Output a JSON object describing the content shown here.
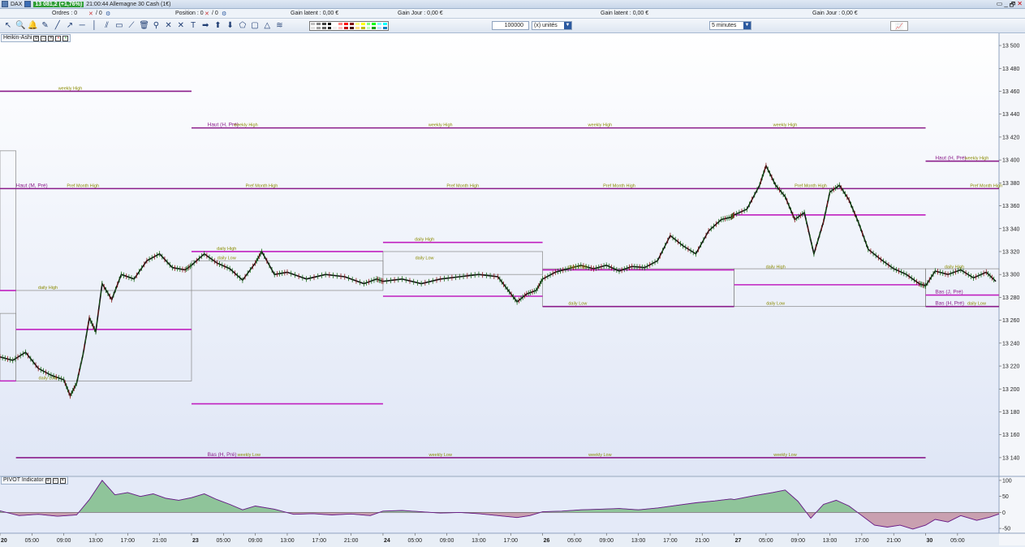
{
  "titlebar": {
    "instrument": "DAX",
    "price_badge": "13 081,2 (+1,76%)",
    "info": "21:00:44 Allemagne 30 Cash (1€)",
    "win_buttons": [
      "▭",
      "_",
      "🗗",
      "✕"
    ]
  },
  "status": {
    "orders_label": "Ordres : 0",
    "orders_count": "/ 0",
    "position_label": "Position : 0",
    "position_count": "/ 0",
    "gain_latent_1": "Gain latent : 0,00 €",
    "gain_jour_1": "Gain Jour : 0,00 €",
    "gain_latent_2": "Gain latent : 0,00 €",
    "gain_jour_2": "Gain Jour : 0,00 €"
  },
  "toolbar": {
    "quantity": "100000",
    "unit": "(x) unités",
    "timeframe": "5 minutes",
    "tools": [
      "pointer-tool",
      "zoom-tool",
      "bell-tool",
      "pencil-tool",
      "line-tool",
      "ray-tool",
      "hline-tool",
      "vline-tool",
      "channel-tool",
      "rect-tool",
      "trend-tool",
      "trash-tool",
      "magnet-tool",
      "xcross-tool",
      "xline-tool",
      "text-tool",
      "arrow-right-tool",
      "arrow-up-tool",
      "arrow-down-tool",
      "shape-tool",
      "box-tool",
      "triangle-tool",
      "fib-tool"
    ],
    "palette": [
      "#c0c0c0",
      "#808080",
      "#404040",
      "#000000",
      "#ffffff",
      "#ff8080",
      "#ff0000",
      "#800000",
      "#ffff80",
      "#ffff00",
      "#80ff80",
      "#00ff00",
      "#80ffff",
      "#00ffff",
      "#e0e0e0",
      "#a0a0a0",
      "#606060",
      "#202020",
      "#f0f0f0",
      "#ffc0c0",
      "#c00000",
      "#400000",
      "#ffe080",
      "#c0c000",
      "#c0ffc0",
      "#00a000",
      "#c0e0ff",
      "#0080c0"
    ]
  },
  "panels": {
    "main_label": "Heikin-Ashi",
    "indicator_label": "PIVOT Indicator"
  },
  "chart_data": {
    "type": "line",
    "title": "",
    "price_axis": {
      "ylim": [
        13130,
        13505
      ],
      "ticks": [
        13500,
        13480,
        13460,
        13440,
        13420,
        13400,
        13380,
        13360,
        13340,
        13320,
        13300,
        13280,
        13260,
        13240,
        13220,
        13200,
        13180,
        13160,
        13140
      ]
    },
    "indicator_axis": {
      "ylim": [
        -65,
        110
      ],
      "ticks": [
        100,
        50,
        0,
        -50
      ],
      "labels": [
        "100",
        "50",
        "0",
        "-50"
      ]
    },
    "time_axis": {
      "labels": [
        {
          "t": 0,
          "text": "20",
          "bold": true
        },
        {
          "t": 1,
          "text": "05:00"
        },
        {
          "t": 2,
          "text": "09:00"
        },
        {
          "t": 3,
          "text": "13:00"
        },
        {
          "t": 4,
          "text": "17:00"
        },
        {
          "t": 5,
          "text": "21:00"
        },
        {
          "t": 6,
          "text": "23",
          "bold": true
        },
        {
          "t": 7,
          "text": "05:00"
        },
        {
          "t": 8,
          "text": "09:00"
        },
        {
          "t": 9,
          "text": "13:00"
        },
        {
          "t": 10,
          "text": "17:00"
        },
        {
          "t": 11,
          "text": "21:00"
        },
        {
          "t": 12,
          "text": "24",
          "bold": true
        },
        {
          "t": 13,
          "text": "05:00"
        },
        {
          "t": 14,
          "text": "09:00"
        },
        {
          "t": 15,
          "text": "13:00"
        },
        {
          "t": 16,
          "text": "17:00"
        },
        {
          "t": 17,
          "text": "26",
          "bold": true
        },
        {
          "t": 18,
          "text": "05:00"
        },
        {
          "t": 19,
          "text": "09:00"
        },
        {
          "t": 20,
          "text": "13:00"
        },
        {
          "t": 21,
          "text": "17:00"
        },
        {
          "t": 22,
          "text": "21:00"
        },
        {
          "t": 23,
          "text": "27",
          "bold": true
        },
        {
          "t": 24,
          "text": "05:00"
        },
        {
          "t": 25,
          "text": "09:00"
        },
        {
          "t": 26,
          "text": "13:00"
        },
        {
          "t": 27,
          "text": "17:00"
        },
        {
          "t": 28,
          "text": "21:00"
        },
        {
          "t": 29,
          "text": "30",
          "bold": true
        },
        {
          "t": 30,
          "text": "05:00"
        }
      ],
      "tmax": 31.3
    },
    "price_series": {
      "name": "",
      "points": [
        [
          0,
          13228
        ],
        [
          0.4,
          13225
        ],
        [
          0.8,
          13232
        ],
        [
          1.2,
          13218
        ],
        [
          1.6,
          13212
        ],
        [
          2.0,
          13208
        ],
        [
          2.2,
          13194
        ],
        [
          2.4,
          13205
        ],
        [
          2.6,
          13230
        ],
        [
          2.8,
          13262
        ],
        [
          3.0,
          13250
        ],
        [
          3.2,
          13292
        ],
        [
          3.5,
          13278
        ],
        [
          3.8,
          13300
        ],
        [
          4.2,
          13296
        ],
        [
          4.6,
          13312
        ],
        [
          5.0,
          13318
        ],
        [
          5.4,
          13306
        ],
        [
          5.8,
          13304
        ],
        [
          6.0,
          13308
        ],
        [
          6.4,
          13318
        ],
        [
          6.8,
          13310
        ],
        [
          7.2,
          13305
        ],
        [
          7.6,
          13295
        ],
        [
          8.0,
          13310
        ],
        [
          8.2,
          13320
        ],
        [
          8.6,
          13300
        ],
        [
          9.0,
          13302
        ],
        [
          9.6,
          13296
        ],
        [
          10.2,
          13300
        ],
        [
          10.8,
          13298
        ],
        [
          11.4,
          13292
        ],
        [
          11.8,
          13296
        ],
        [
          12.0,
          13294
        ],
        [
          12.6,
          13296
        ],
        [
          13.2,
          13292
        ],
        [
          13.8,
          13296
        ],
        [
          14.4,
          13298
        ],
        [
          15.0,
          13300
        ],
        [
          15.6,
          13298
        ],
        [
          15.9,
          13287
        ],
        [
          16.2,
          13276
        ],
        [
          16.5,
          13283
        ],
        [
          16.8,
          13286
        ],
        [
          17.0,
          13296
        ],
        [
          17.4,
          13302
        ],
        [
          17.8,
          13305
        ],
        [
          18.2,
          13308
        ],
        [
          18.6,
          13305
        ],
        [
          19.0,
          13308
        ],
        [
          19.4,
          13303
        ],
        [
          19.8,
          13307
        ],
        [
          20.2,
          13306
        ],
        [
          20.6,
          13312
        ],
        [
          21.0,
          13334
        ],
        [
          21.4,
          13325
        ],
        [
          21.8,
          13318
        ],
        [
          22.2,
          13338
        ],
        [
          22.6,
          13348
        ],
        [
          22.9,
          13350
        ],
        [
          23.0,
          13352
        ],
        [
          23.4,
          13357
        ],
        [
          23.8,
          13378
        ],
        [
          24.0,
          13395
        ],
        [
          24.3,
          13378
        ],
        [
          24.6,
          13368
        ],
        [
          24.9,
          13348
        ],
        [
          25.2,
          13354
        ],
        [
          25.5,
          13318
        ],
        [
          25.8,
          13346
        ],
        [
          26.0,
          13372
        ],
        [
          26.3,
          13378
        ],
        [
          26.6,
          13365
        ],
        [
          26.9,
          13345
        ],
        [
          27.2,
          13322
        ],
        [
          27.6,
          13313
        ],
        [
          28.0,
          13305
        ],
        [
          28.4,
          13300
        ],
        [
          28.8,
          13292
        ],
        [
          29.0,
          13290
        ],
        [
          29.3,
          13303
        ],
        [
          29.7,
          13300
        ],
        [
          30.1,
          13304
        ],
        [
          30.5,
          13297
        ],
        [
          30.9,
          13302
        ],
        [
          31.2,
          13294
        ]
      ]
    },
    "levels": [
      {
        "name": "weekly High",
        "y": 13460,
        "t0": 0,
        "t1": 6,
        "color": "#8a1c8a"
      },
      {
        "name": "weekly High",
        "y": 13428,
        "t0": 6,
        "t1": 29,
        "color": "#8a1c8a"
      },
      {
        "name": "weekly High",
        "y": 13399,
        "t0": 29,
        "t1": 31.3,
        "color": "#8a1c8a"
      },
      {
        "name": "Pref Month High",
        "y": 13375,
        "t0": 0,
        "t1": 31.3,
        "color": "#8a1c8a"
      },
      {
        "name": "weekly Low",
        "y": 13140,
        "t0": 0.5,
        "t1": 29,
        "color": "#8a1c8a"
      },
      {
        "name": "daily High",
        "y": 13286,
        "t0": 0,
        "t1": 0.5,
        "color": "#c020c0"
      },
      {
        "name": "daily Low",
        "y": 13207,
        "t0": 0,
        "t1": 0.5,
        "color": "#c020c0"
      },
      {
        "name": "mid",
        "y": 13252,
        "t0": 0.5,
        "t1": 6,
        "color": "#c020c0"
      },
      {
        "name": "daily High",
        "y": 13320,
        "t0": 6,
        "t1": 12,
        "color": "#c020c0"
      },
      {
        "name": "daily Low",
        "y": 13187,
        "t0": 6,
        "t1": 12,
        "color": "#c020c0"
      },
      {
        "name": "daily High",
        "y": 13328,
        "t0": 12,
        "t1": 17,
        "color": "#c020c0"
      },
      {
        "name": "daily Low",
        "y": 13281,
        "t0": 12,
        "t1": 17,
        "color": "#c020c0"
      },
      {
        "name": "daily High",
        "y": 13304,
        "t0": 17,
        "t1": 23,
        "color": "#c020c0"
      },
      {
        "name": "daily Low",
        "y": 13272,
        "t0": 17,
        "t1": 23,
        "color": "#8a1c8a"
      },
      {
        "name": "daily High",
        "y": 13352,
        "t0": 23,
        "t1": 29,
        "color": "#c020c0"
      },
      {
        "name": "daily Low",
        "y": 13291,
        "t0": 23,
        "t1": 29,
        "color": "#c020c0"
      },
      {
        "name": "daily High",
        "y": 13282,
        "t0": 29,
        "t1": 31.3,
        "color": "#c020c0"
      },
      {
        "name": "daily Low",
        "y": 13272,
        "t0": 29,
        "t1": 31.3,
        "color": "#8a1c8a"
      }
    ],
    "range_boxes": [
      {
        "t0": 0,
        "t1": 0.5,
        "y0": 13408,
        "y1": 13286
      },
      {
        "t0": 0,
        "t1": 0.5,
        "y0": 13266,
        "y1": 13207
      },
      {
        "t0": 0.5,
        "t1": 6,
        "y0": 13286,
        "y1": 13207
      },
      {
        "t0": 6,
        "t1": 12,
        "y0": 13312,
        "y1": 13286
      },
      {
        "t0": 12,
        "t1": 17,
        "y0": 13320,
        "y1": 13300
      },
      {
        "t0": 17,
        "t1": 23,
        "y0": 13305,
        "y1": 13272
      },
      {
        "t0": 23,
        "t1": 29,
        "y0": 13305,
        "y1": 13272
      },
      {
        "t0": 29,
        "t1": 31.3,
        "y0": 13305,
        "y1": 13272
      }
    ],
    "annotations": [
      {
        "text": "weekly High",
        "t": 2.2,
        "y": 13460
      },
      {
        "text": "Haut (H, Pré)",
        "t": 6.5,
        "y": 13428
      },
      {
        "text": "weekly High",
        "t": 7.7,
        "y": 13428
      },
      {
        "text": "weekly High",
        "t": 13.8,
        "y": 13428
      },
      {
        "text": "weekly High",
        "t": 18.8,
        "y": 13428
      },
      {
        "text": "weekly High",
        "t": 24.6,
        "y": 13428
      },
      {
        "text": "Haut (H, Pré)",
        "t": 29.3,
        "y": 13399
      },
      {
        "text": "weekly High",
        "t": 30.6,
        "y": 13399
      },
      {
        "text": "Haut (M, Pré)",
        "t": 0.5,
        "y": 13375
      },
      {
        "text": "Pref Month High",
        "t": 2.6,
        "y": 13375
      },
      {
        "text": "Pref Month High",
        "t": 8.2,
        "y": 13375
      },
      {
        "text": "Pref Month High",
        "t": 14.5,
        "y": 13375
      },
      {
        "text": "Pref Month High",
        "t": 19.4,
        "y": 13375
      },
      {
        "text": "Pref Month High",
        "t": 25.4,
        "y": 13375
      },
      {
        "text": "Pref Month High",
        "t": 30.9,
        "y": 13375
      },
      {
        "text": "daily High",
        "t": 1.5,
        "y": 13286
      },
      {
        "text": "daily Low",
        "t": 1.5,
        "y": 13207
      },
      {
        "text": "daily High",
        "t": 7.1,
        "y": 13320
      },
      {
        "text": "daily Low",
        "t": 7.1,
        "y": 13312
      },
      {
        "text": "daily High",
        "t": 13.3,
        "y": 13328
      },
      {
        "text": "daily Low",
        "t": 13.3,
        "y": 13312
      },
      {
        "text": "daily High",
        "t": 18.1,
        "y": 13304
      },
      {
        "text": "daily Low",
        "t": 18.1,
        "y": 13272
      },
      {
        "text": "daily High",
        "t": 24.3,
        "y": 13304
      },
      {
        "text": "daily Low",
        "t": 24.3,
        "y": 13272
      },
      {
        "text": "daily High",
        "t": 29.9,
        "y": 13304
      },
      {
        "text": "Bas (J, Pré)",
        "t": 29.3,
        "y": 13282
      },
      {
        "text": "Bas (H, Pré)",
        "t": 29.3,
        "y": 13272
      },
      {
        "text": "daily Low",
        "t": 30.6,
        "y": 13272
      },
      {
        "text": "Bas (H, Pré)",
        "t": 6.5,
        "y": 13140
      },
      {
        "text": "weekly Low",
        "t": 7.8,
        "y": 13140
      },
      {
        "text": "weekly Low",
        "t": 13.8,
        "y": 13140
      },
      {
        "text": "weekly Low",
        "t": 18.8,
        "y": 13140
      },
      {
        "text": "weekly Low",
        "t": 24.6,
        "y": 13140
      }
    ],
    "indicator_series": {
      "points": [
        [
          0,
          5
        ],
        [
          0.6,
          -10
        ],
        [
          1.2,
          -6
        ],
        [
          1.8,
          -12
        ],
        [
          2.4,
          -8
        ],
        [
          2.8,
          40
        ],
        [
          3.2,
          100
        ],
        [
          3.6,
          55
        ],
        [
          4.0,
          62
        ],
        [
          4.4,
          50
        ],
        [
          4.8,
          58
        ],
        [
          5.2,
          44
        ],
        [
          5.6,
          38
        ],
        [
          6.0,
          46
        ],
        [
          6.4,
          58
        ],
        [
          6.8,
          40
        ],
        [
          7.2,
          25
        ],
        [
          7.6,
          8
        ],
        [
          8.0,
          20
        ],
        [
          8.6,
          10
        ],
        [
          9.2,
          -6
        ],
        [
          9.8,
          -4
        ],
        [
          10.4,
          -8
        ],
        [
          11.0,
          -5
        ],
        [
          11.6,
          -10
        ],
        [
          12.0,
          4
        ],
        [
          12.6,
          6
        ],
        [
          13.2,
          2
        ],
        [
          13.8,
          -2
        ],
        [
          14.4,
          0
        ],
        [
          15.0,
          -4
        ],
        [
          15.6,
          -10
        ],
        [
          16.2,
          -16
        ],
        [
          16.6,
          -10
        ],
        [
          17.0,
          2
        ],
        [
          17.6,
          4
        ],
        [
          18.2,
          8
        ],
        [
          18.8,
          10
        ],
        [
          19.4,
          12
        ],
        [
          20.0,
          8
        ],
        [
          20.6,
          14
        ],
        [
          21.2,
          22
        ],
        [
          21.8,
          30
        ],
        [
          22.4,
          36
        ],
        [
          22.9,
          42
        ],
        [
          23.0,
          40
        ],
        [
          23.6,
          52
        ],
        [
          24.2,
          62
        ],
        [
          24.6,
          70
        ],
        [
          25.0,
          35
        ],
        [
          25.4,
          -18
        ],
        [
          25.8,
          25
        ],
        [
          26.2,
          38
        ],
        [
          26.6,
          20
        ],
        [
          27.0,
          -10
        ],
        [
          27.4,
          -40
        ],
        [
          27.8,
          -46
        ],
        [
          28.2,
          -40
        ],
        [
          28.6,
          -52
        ],
        [
          29.0,
          -40
        ],
        [
          29.3,
          -22
        ],
        [
          29.7,
          -30
        ],
        [
          30.1,
          -10
        ],
        [
          30.6,
          -25
        ],
        [
          31.0,
          -15
        ],
        [
          31.3,
          -5
        ]
      ]
    }
  }
}
